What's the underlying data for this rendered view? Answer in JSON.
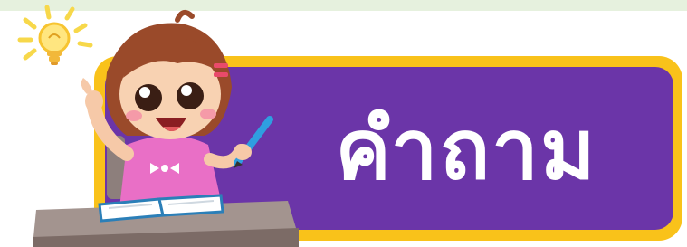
{
  "banner": {
    "title": "คำถาม",
    "accent_color": "#f9c21a",
    "panel_color": "#6b35a8"
  },
  "illustration": {
    "icons": [
      "lightbulb-icon",
      "girl-student-illustration",
      "book-icon",
      "pencil-icon",
      "desk-icon"
    ]
  }
}
